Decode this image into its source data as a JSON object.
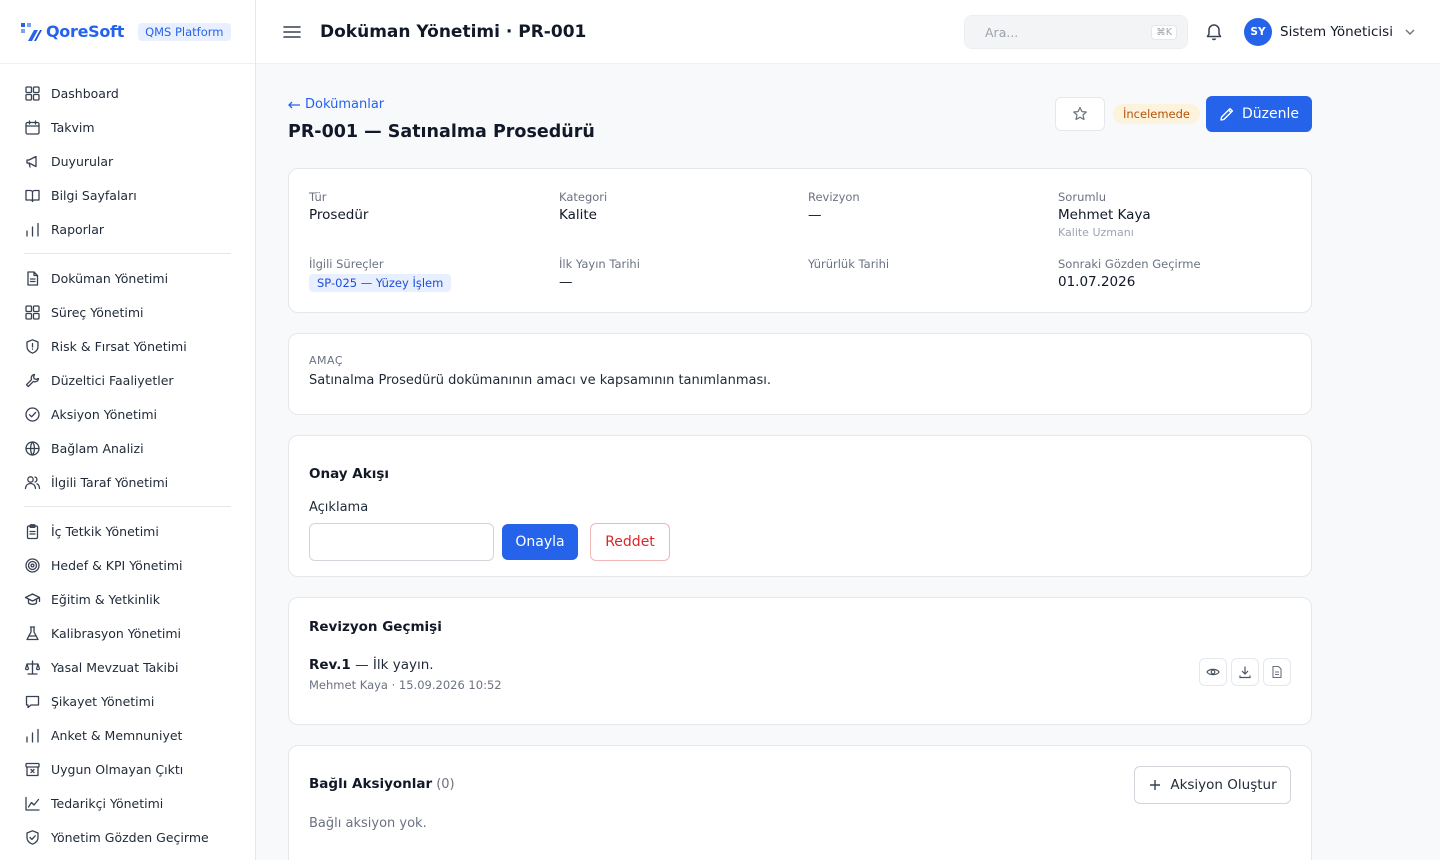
{
  "brand": {
    "name": "QoreSoft",
    "badge": "QMS Platform",
    "color": "#2563eb"
  },
  "sidebar": {
    "groups": [
      [
        {
          "label": "Dashboard",
          "icon": "grid-icon"
        },
        {
          "label": "Takvim",
          "icon": "calendar-icon"
        },
        {
          "label": "Duyurular",
          "icon": "megaphone-icon"
        },
        {
          "label": "Bilgi Sayfaları",
          "icon": "book-icon"
        },
        {
          "label": "Raporlar",
          "icon": "bar-chart-icon"
        }
      ],
      [
        {
          "label": "Doküman Yönetimi",
          "icon": "file-icon"
        },
        {
          "label": "Süreç Yönetimi",
          "icon": "grid-icon"
        },
        {
          "label": "Risk & Fırsat Yönetimi",
          "icon": "shield-alert-icon"
        },
        {
          "label": "Düzeltici Faaliyetler",
          "icon": "wrench-icon"
        },
        {
          "label": "Aksiyon Yönetimi",
          "icon": "check-circle-icon"
        },
        {
          "label": "Bağlam Analizi",
          "icon": "globe-icon"
        },
        {
          "label": "İlgili Taraf Yönetimi",
          "icon": "users-icon"
        }
      ],
      [
        {
          "label": "İç Tetkik Yönetimi",
          "icon": "clipboard-icon"
        },
        {
          "label": "Hedef & KPI Yönetimi",
          "icon": "target-icon"
        },
        {
          "label": "Eğitim & Yetkinlik",
          "icon": "graduation-cap-icon"
        },
        {
          "label": "Kalibrasyon Yönetimi",
          "icon": "flask-icon"
        },
        {
          "label": "Yasal Mevzuat Takibi",
          "icon": "scale-icon"
        },
        {
          "label": "Şikayet Yönetimi",
          "icon": "message-icon"
        },
        {
          "label": "Anket & Memnuniyet",
          "icon": "bar-chart-icon"
        },
        {
          "label": "Uygun Olmayan Çıktı",
          "icon": "archive-x-icon"
        },
        {
          "label": "Tedarikçi Yönetimi",
          "icon": "line-chart-icon"
        },
        {
          "label": "Yönetim Gözden Geçirme",
          "icon": "shield-check-icon"
        }
      ]
    ]
  },
  "topbar": {
    "title": "Doküman Yönetimi · PR-001",
    "search_placeholder": "Ara...",
    "search_shortcut": "⌘K",
    "user_initials": "SY",
    "user_name": "Sistem Yöneticisi"
  },
  "header": {
    "back_label": "Dokümanlar",
    "title": "PR-001 — Satınalma Prosedürü",
    "status": "İncelemede",
    "edit_label": "Düzenle"
  },
  "meta": {
    "type_label": "Tür",
    "type_value": "Prosedür",
    "category_label": "Kategori",
    "category_value": "Kalite",
    "revision_label": "Revizyon",
    "revision_value": "—",
    "owner_label": "Sorumlu",
    "owner_value": "Mehmet Kaya",
    "owner_role": "Kalite Uzmanı",
    "processes_label": "İlgili Süreçler",
    "processes_value": "SP-025 — Yüzey İşlem",
    "first_pub_label": "İlk Yayın Tarihi",
    "first_pub_value": "—",
    "effective_label": "Yürürlük Tarihi",
    "next_review_label": "Sonraki Gözden Geçirme",
    "next_review_value": "01.07.2026"
  },
  "purpose": {
    "caption": "AMAÇ",
    "text": "Satınalma Prosedürü dokümanının amacı ve kapsamının tanımlanması."
  },
  "approval": {
    "title": "Onay Akışı",
    "field_label": "Açıklama",
    "field_value": "",
    "approve_label": "Onayla",
    "reject_label": "Reddet"
  },
  "revisions": {
    "title": "Revizyon Geçmişi",
    "items": [
      {
        "rev": "Rev.1",
        "note": " — İlk yayın.",
        "meta": "Mehmet Kaya · 15.09.2026 10:52"
      }
    ]
  },
  "linked_actions": {
    "title": "Bağlı Aksiyonlar",
    "count": "(0)",
    "create_label": "Aksiyon Oluştur",
    "empty_text": "Bağlı aksiyon yok."
  }
}
